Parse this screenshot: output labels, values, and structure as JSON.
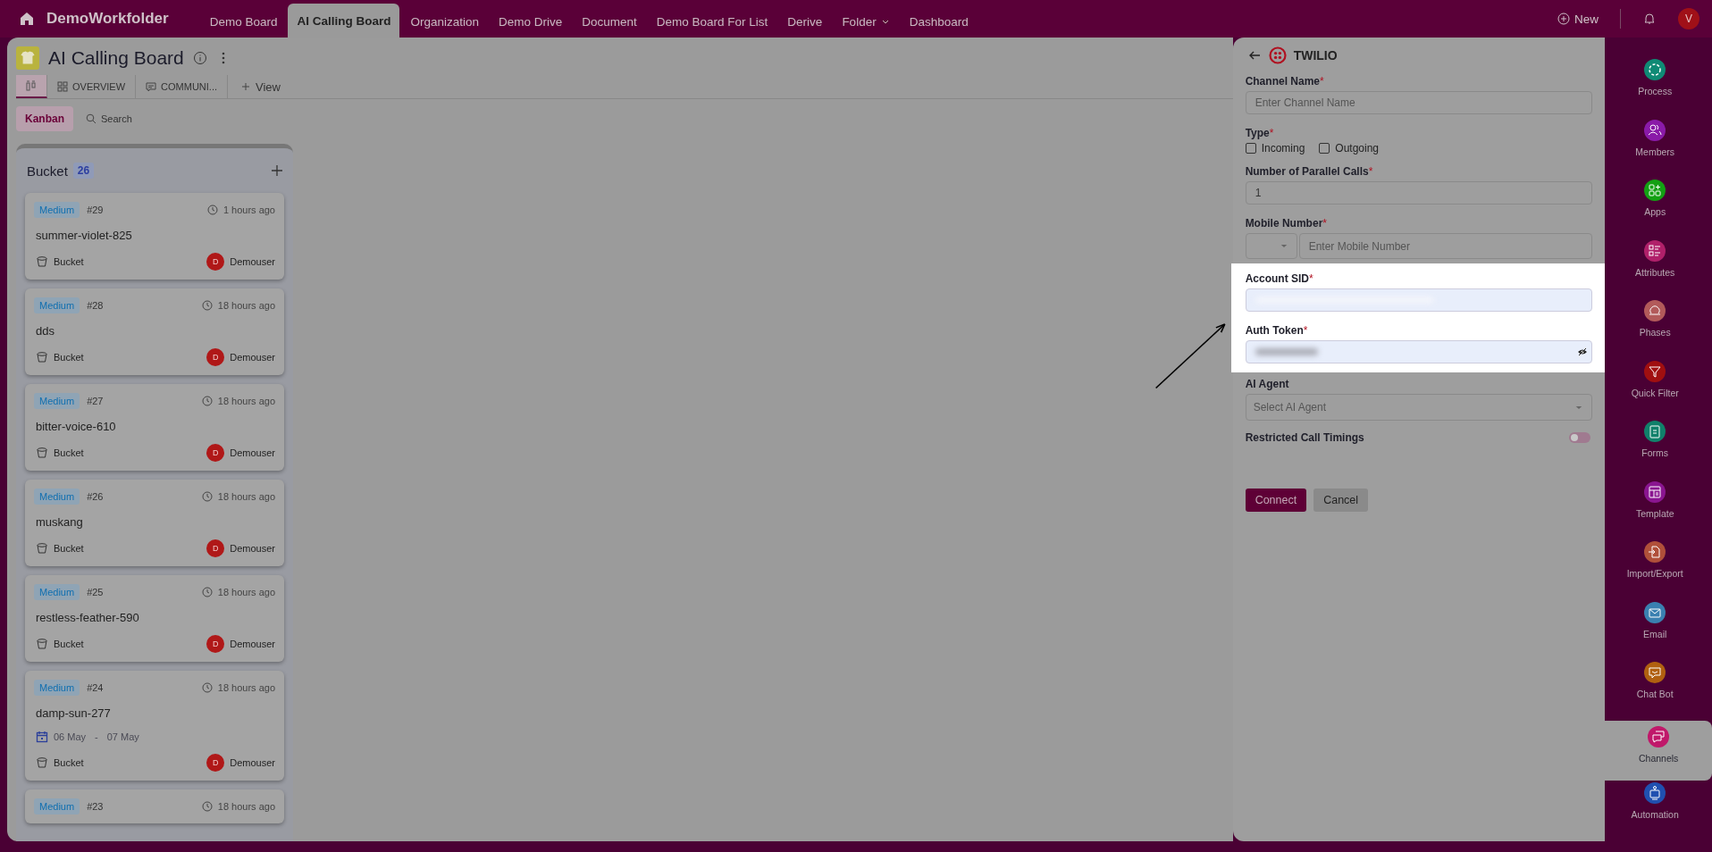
{
  "topbar": {
    "app_name": "DemoWorkfolder",
    "nav": [
      {
        "label": "Demo Board",
        "selected": false
      },
      {
        "label": "AI Calling Board",
        "selected": true
      },
      {
        "label": "Organization",
        "selected": false
      },
      {
        "label": "Demo Drive",
        "selected": false
      },
      {
        "label": "Document",
        "selected": false
      },
      {
        "label": "Demo Board For List",
        "selected": false
      },
      {
        "label": "Derive",
        "selected": false
      },
      {
        "label": "Folder",
        "selected": false,
        "dropdown": true
      },
      {
        "label": "Dashboard",
        "selected": false
      }
    ],
    "new_label": "New",
    "avatar": "V"
  },
  "board": {
    "title": "AI Calling Board",
    "view_tabs": [
      {
        "selected": true
      },
      {
        "label": "OVERVIEW",
        "selected": false
      },
      {
        "label": "COMMUNI...",
        "selected": false
      }
    ],
    "add_view": "View",
    "mode": {
      "label": "Kanban",
      "selected": true
    },
    "search": "Search",
    "column": {
      "title": "Bucket",
      "count": "26",
      "cards": [
        {
          "priority": "Medium",
          "number": "#29",
          "time": "1 hours ago",
          "title": "summer-violet-825",
          "bucket": "Bucket",
          "user": "Demouser",
          "user_initial": "D"
        },
        {
          "priority": "Medium",
          "number": "#28",
          "time": "18 hours ago",
          "title": "dds",
          "bucket": "Bucket",
          "user": "Demouser",
          "user_initial": "D"
        },
        {
          "priority": "Medium",
          "number": "#27",
          "time": "18 hours ago",
          "title": "bitter-voice-610",
          "bucket": "Bucket",
          "user": "Demouser",
          "user_initial": "D"
        },
        {
          "priority": "Medium",
          "number": "#26",
          "time": "18 hours ago",
          "title": "muskang",
          "bucket": "Bucket",
          "user": "Demouser",
          "user_initial": "D"
        },
        {
          "priority": "Medium",
          "number": "#25",
          "time": "18 hours ago",
          "title": "restless-feather-590",
          "bucket": "Bucket",
          "user": "Demouser",
          "user_initial": "D"
        },
        {
          "priority": "Medium",
          "number": "#24",
          "time": "18 hours ago",
          "title": "damp-sun-277",
          "date_from": "06 May",
          "date_sep": "-",
          "date_to": "07 May",
          "bucket": "Bucket",
          "user": "Demouser",
          "user_initial": "D"
        },
        {
          "priority": "Medium",
          "number": "#23",
          "time": "18 hours ago"
        }
      ]
    }
  },
  "form": {
    "title": "TWILIO",
    "channel_name": {
      "label": "Channel Name",
      "required_mark": "*",
      "placeholder": "Enter Channel Name"
    },
    "type": {
      "label": "Type",
      "required_mark": "*",
      "options": [
        {
          "label": "Incoming",
          "checked": false
        },
        {
          "label": "Outgoing",
          "checked": false
        }
      ]
    },
    "parallel_calls": {
      "label": "Number of Parallel Calls",
      "required_mark": "*",
      "value": "1"
    },
    "mobile": {
      "label": "Mobile Number",
      "required_mark": "*",
      "placeholder": "Enter Mobile Number"
    },
    "account_sid": {
      "label": "Account SID",
      "required_mark": "*"
    },
    "auth_token": {
      "label": "Auth Token",
      "required_mark": "*"
    },
    "ai_agent": {
      "label": "AI Agent",
      "placeholder": "Select AI Agent"
    },
    "restricted": {
      "label": "Restricted Call Timings",
      "on": false
    },
    "buttons": [
      "Connect",
      "Cancel"
    ]
  },
  "sidebar": [
    {
      "label": "Process",
      "color": "#0f8a75",
      "selected": false
    },
    {
      "label": "Members",
      "color": "#8a1aa8",
      "selected": false
    },
    {
      "label": "Apps",
      "color": "#13a013",
      "selected": false
    },
    {
      "label": "Attributes",
      "color": "#b0206a",
      "selected": false
    },
    {
      "label": "Phases",
      "color": "#b25a5a",
      "selected": false
    },
    {
      "label": "Quick Filter",
      "color": "#a00f10",
      "selected": false
    },
    {
      "label": "Forms",
      "color": "#10806a",
      "selected": false
    },
    {
      "label": "Template",
      "color": "#8a1590",
      "selected": false
    },
    {
      "label": "Import/Export",
      "color": "#b0503a",
      "selected": false
    },
    {
      "label": "Email",
      "color": "#3a80b0",
      "selected": false
    },
    {
      "label": "Chat Bot",
      "color": "#b06010",
      "selected": false
    },
    {
      "label": "Channels",
      "color": "#c0186a",
      "selected": true
    },
    {
      "label": "Automation",
      "color": "#2050b0",
      "selected": false
    }
  ]
}
